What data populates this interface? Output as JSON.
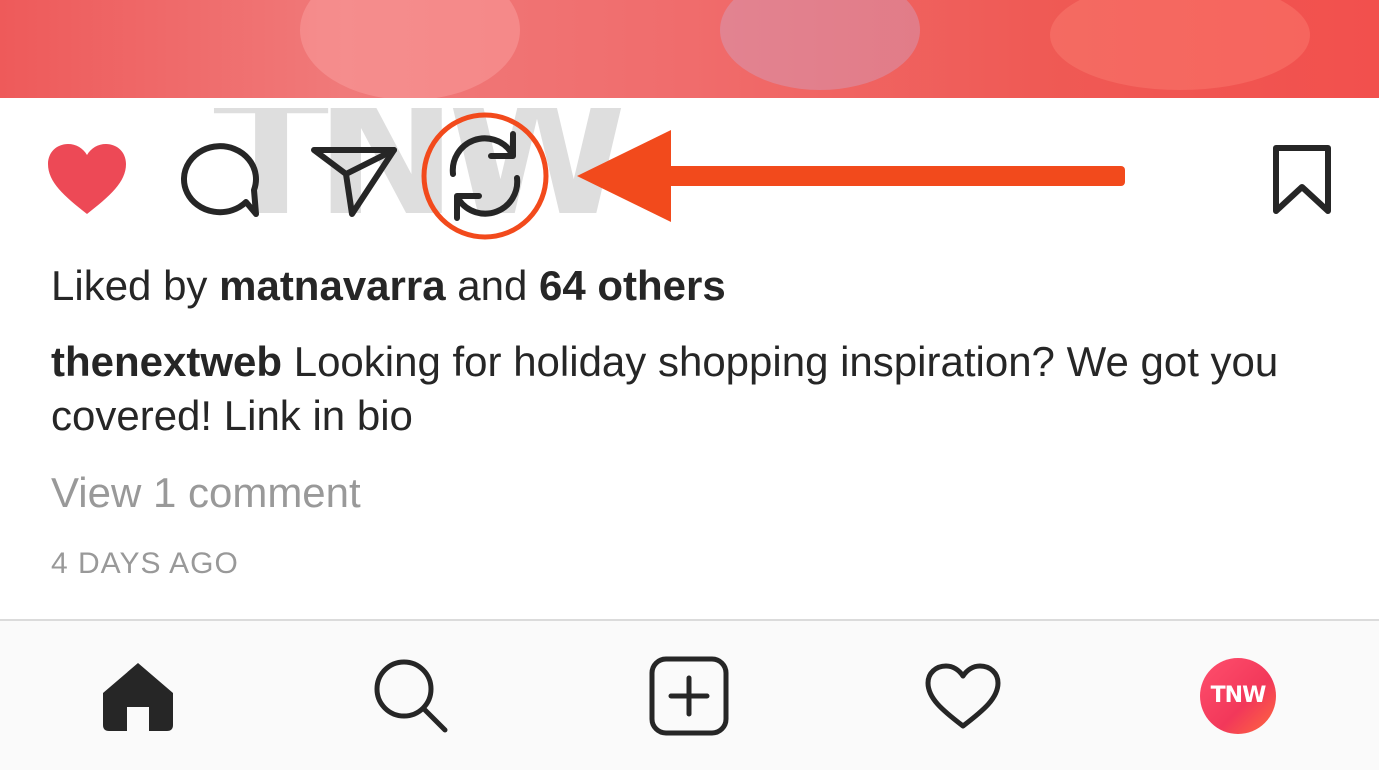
{
  "post": {
    "watermark_text": "TNW",
    "likes": {
      "prefix": "Liked by ",
      "user": "matnavarra",
      "connector": " and ",
      "others": "64 others"
    },
    "caption": {
      "username": "thenextweb",
      "text": " Looking for holiday shopping inspiration? We got you covered! Link in bio"
    },
    "view_comments_label": "View 1 comment",
    "timestamp": "4 DAYS AGO"
  },
  "actions": {
    "like_icon": "heart-filled-icon",
    "comment_icon": "comment-bubble-icon",
    "share_icon": "paper-plane-icon",
    "regram_icon": "repost-cycle-icon",
    "save_icon": "bookmark-icon",
    "like_color": "#ed4956",
    "highlight_color": "#f24a1c"
  },
  "tabbar": {
    "items": [
      {
        "name": "home",
        "icon": "home-icon"
      },
      {
        "name": "search",
        "icon": "search-icon"
      },
      {
        "name": "new-post",
        "icon": "plus-square-icon"
      },
      {
        "name": "activity",
        "icon": "heart-outline-icon"
      },
      {
        "name": "profile",
        "icon": "avatar-icon"
      }
    ],
    "profile_avatar_text": "TNW",
    "avatar_color": "#f2385a"
  }
}
